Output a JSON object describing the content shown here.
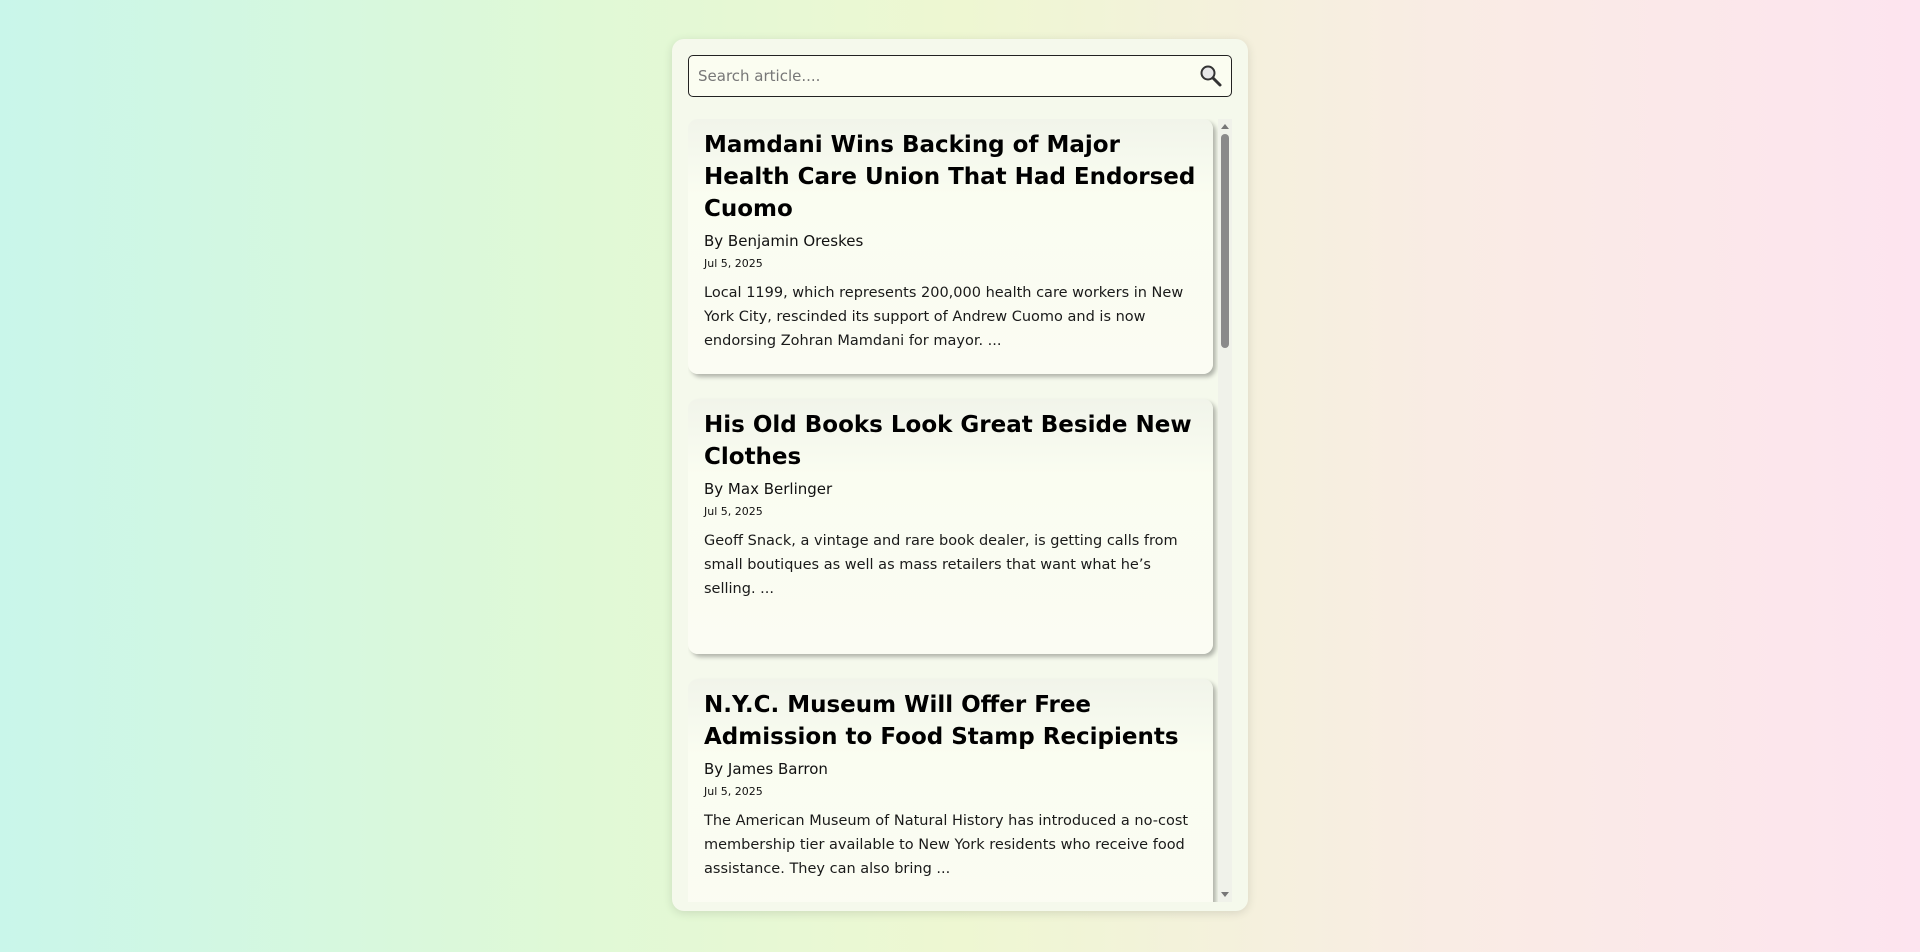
{
  "search": {
    "placeholder": "Search article....",
    "value": ""
  },
  "articles": [
    {
      "title": "Mamdani Wins Backing of Major Health Care Union That Had Endorsed Cuomo",
      "author": "By Benjamin Oreskes",
      "date": "Jul 5, 2025",
      "summary": "Local 1199, which represents 200,000 health care workers in New York City, rescinded its support of Andrew Cuomo and is now endorsing Zohran Mamdani for mayor. ..."
    },
    {
      "title": "His Old Books Look Great Beside New Clothes",
      "author": "By Max Berlinger",
      "date": "Jul 5, 2025",
      "summary": "Geoff Snack, a vintage and rare book dealer, is getting calls from small boutiques as well as mass retailers that want what he’s selling. ..."
    },
    {
      "title": "N.Y.C. Museum Will Offer Free Admission to Food Stamp Recipients",
      "author": "By James Barron",
      "date": "Jul 5, 2025",
      "summary": "The American Museum of Natural History has introduced a no-cost membership tier available to New York residents who receive food assistance. They can also bring ..."
    }
  ],
  "icons": {
    "search": "search-icon"
  }
}
